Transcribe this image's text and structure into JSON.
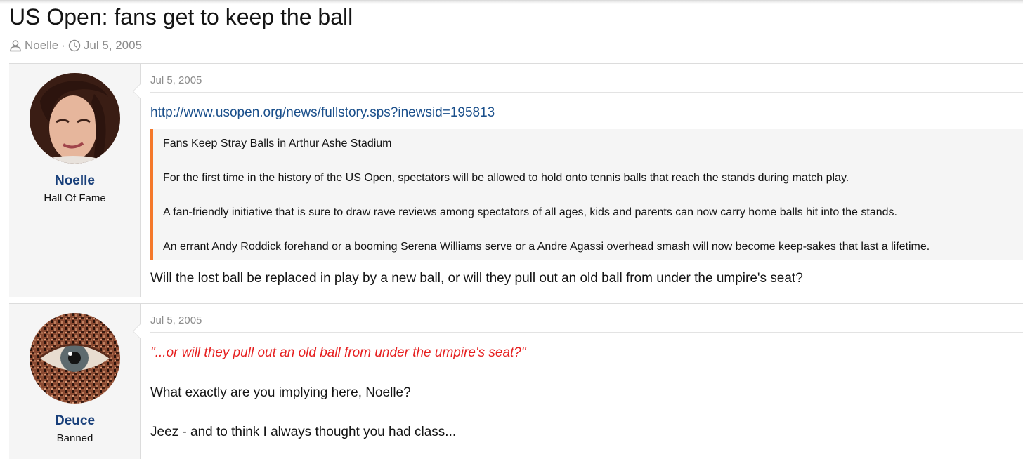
{
  "thread": {
    "title": "US Open: fans get to keep the ball",
    "author": "Noelle",
    "separator": "·",
    "date": "Jul 5, 2005"
  },
  "posts": [
    {
      "username": "Noelle",
      "user_title": "Hall Of Fame",
      "date": "Jul 5, 2005",
      "link": "http://www.usopen.org/news/fullstory.sps?inewsid=195813",
      "quote": [
        "Fans Keep Stray Balls in Arthur Ashe Stadium",
        "For the first time in the history of the US Open, spectators will be allowed to hold onto tennis balls that reach the stands during match play.",
        "A fan-friendly initiative that is sure to draw rave reviews among spectators of all ages, kids and parents can now carry home balls hit into the stands.",
        "An errant Andy Roddick forehand or a booming Serena Williams serve or a Andre Agassi overhead smash will now become keep-sakes that last a lifetime."
      ],
      "text": "Will the lost ball be replaced in play by a new ball, or will they pull out an old ball from under the umpire's seat?"
    },
    {
      "username": "Deuce",
      "user_title": "Banned",
      "date": "Jul 5, 2005",
      "quoted_line": "\"...or will they pull out an old ball from under the umpire's seat?\"",
      "line_2": "What exactly are you implying here, Noelle?",
      "line_3": "Jeez - and to think I always thought you had class..."
    }
  ],
  "icons": {
    "author": "user-icon",
    "date": "clock-icon"
  },
  "colors": {
    "username": "#183f7a",
    "link": "#1a4f8b",
    "quote_bar": "#f4782a",
    "quoted_text": "#e62020"
  }
}
